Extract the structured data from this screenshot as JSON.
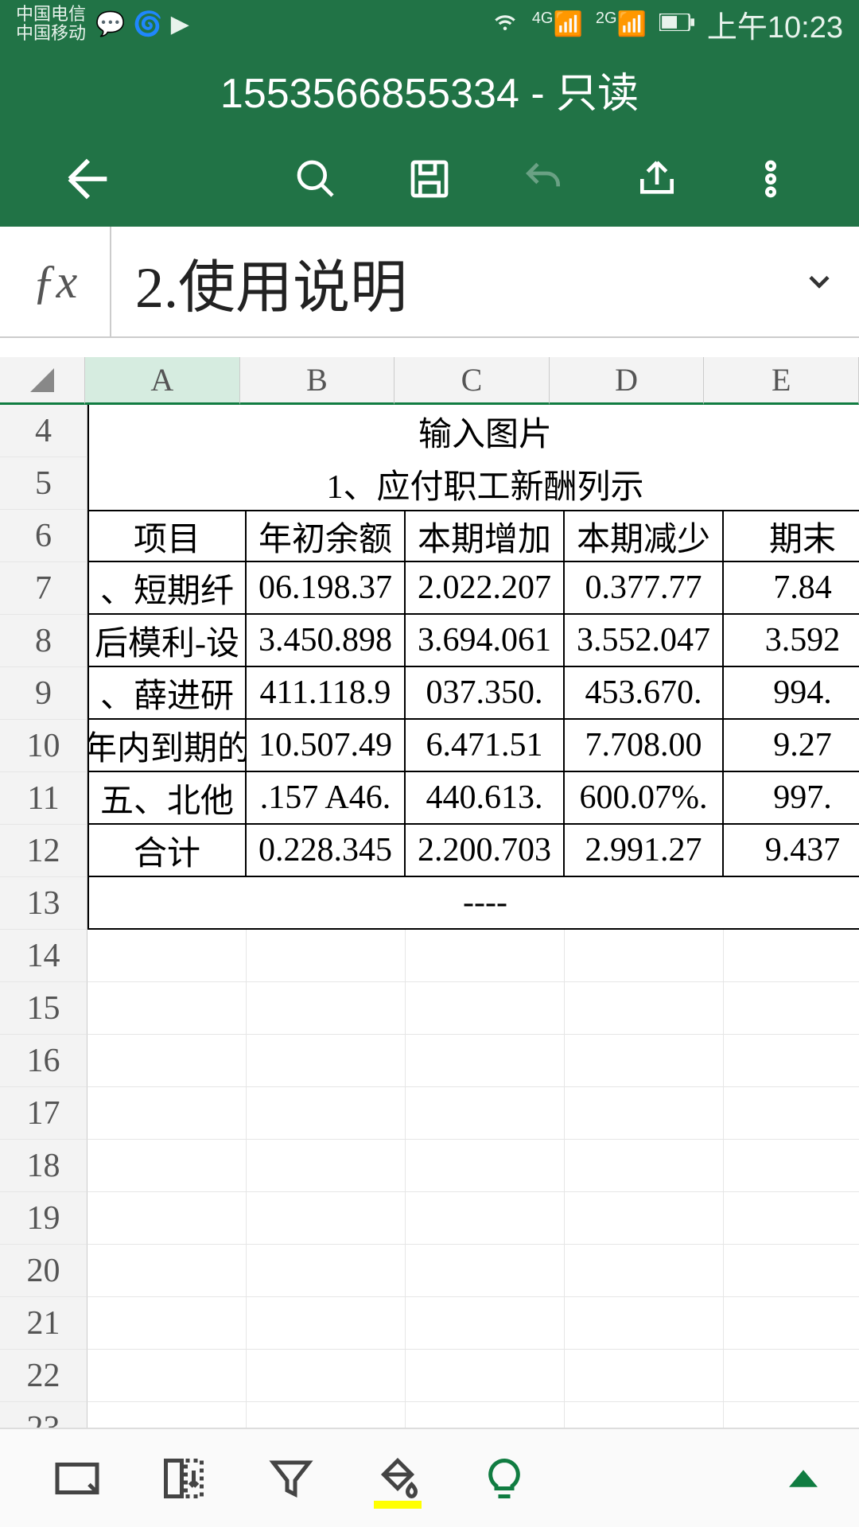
{
  "status": {
    "carrier1": "中国电信",
    "carrier2": "中国移动",
    "net1": "4G",
    "net2": "2G",
    "time": "上午10:23"
  },
  "title": "1553566855334 - 只读",
  "formula_value": "2.使用说明",
  "columns": [
    "A",
    "B",
    "C",
    "D",
    "E"
  ],
  "row_start": 4,
  "row_end": 24,
  "content": {
    "4": {
      "merged": "输入图片"
    },
    "5": {
      "merged": "1、应付职工新酬列示"
    },
    "6": {
      "A": "项目",
      "B": "年初余额",
      "C": "本期增加",
      "D": "本期减少",
      "E": "期末"
    },
    "7": {
      "A": "、短期纤",
      "B": "06.198.37",
      "C": "2.022.207",
      "D": "0.377.77",
      "E": "7.84"
    },
    "8": {
      "A": "后模利-设",
      "B": "3.450.898",
      "C": "3.694.061",
      "D": "3.552.047",
      "E": "3.592"
    },
    "9": {
      "A": "、薛进研",
      "B": "411.118.9",
      "C": "037.350.",
      "D": "453.670.",
      "E": "994."
    },
    "10": {
      "A": "年内到期的",
      "B": "10.507.49",
      "C": "6.471.51",
      "D": "7.708.00",
      "E": "9.27"
    },
    "11": {
      "A": "五、北他",
      "B": ".157 A46.",
      "C": "440.613.",
      "D": "600.07%.",
      "E": "997."
    },
    "12": {
      "A": "合计",
      "B": "0.228.345",
      "C": "2.200.703",
      "D": "2.991.27",
      "E": "9.437"
    },
    "13": {
      "merged": "----"
    }
  }
}
